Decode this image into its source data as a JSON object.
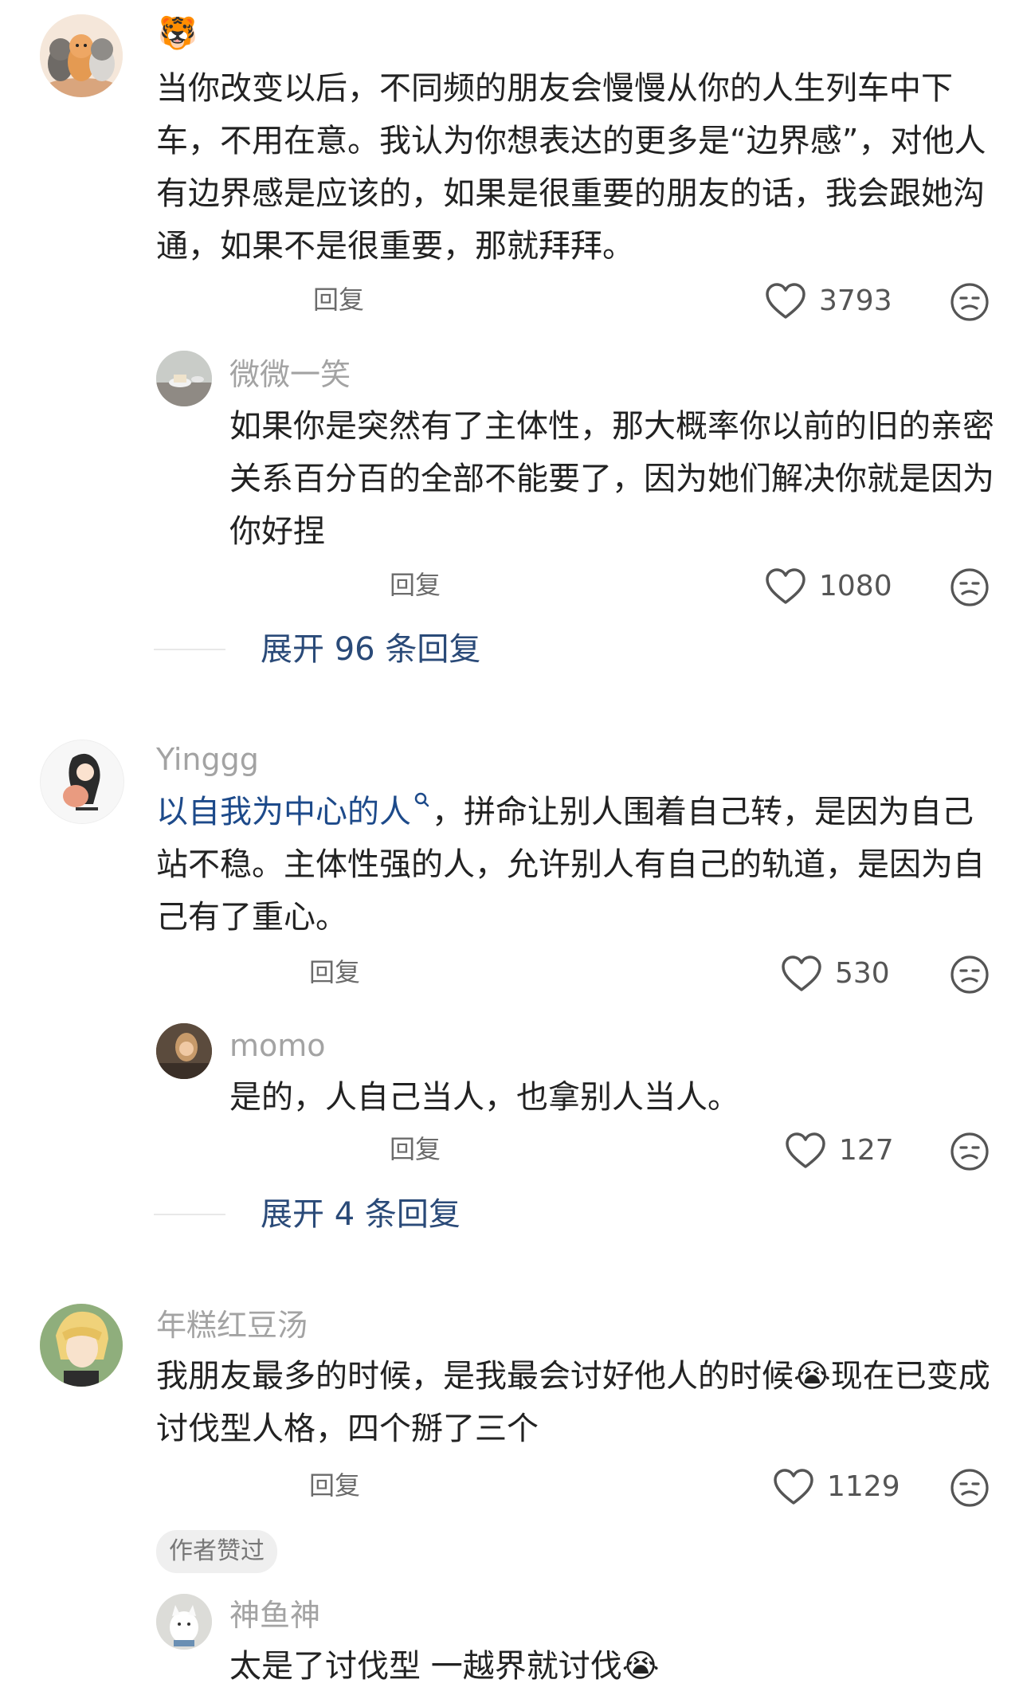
{
  "comments": [
    {
      "emoji": "🐯",
      "text": "当你改变以后，不同频的朋友会慢慢从你的人生列车中下车，不用在意。我认为你想表达的更多是“边界感”，对他人有边界感是应该的，如果是很重要的朋友的话，我会跟她沟通，如果不是很重要，那就拜拜。",
      "reply_label": "回复",
      "likes": "3793",
      "reply": {
        "name": "微微一笑",
        "text": "如果你是突然有了主体性，那大概率你以前的旧的亲密关系百分百的全部不能要了，因为她们解决你就是因为你好捏",
        "reply_label": "回复",
        "likes": "1080"
      },
      "expand": "展开 96 条回复"
    },
    {
      "name": "Yinggg",
      "link_text": "以自我为中心的人",
      "text_rest": "，拼命让别人围着自己转，是因为自己站不稳。主体性强的人，允许别人有自己的轨道，是因为自己有了重心。",
      "reply_label": "回复",
      "likes": "530",
      "reply": {
        "name": "momo",
        "text": "是的，人自己当人，也拿别人当人。",
        "reply_label": "回复",
        "likes": "127"
      },
      "expand": "展开 4 条回复"
    },
    {
      "name": "年糕红豆汤",
      "text": "我朋友最多的时候，是我最会讨好他人的时候😭现在已变成讨伐型人格，四个掰了三个",
      "reply_label": "回复",
      "likes": "1129",
      "badge": "作者赞过",
      "reply": {
        "name": "神鱼神",
        "text": "太是了讨伐型 一越界就讨伐😭"
      }
    }
  ]
}
